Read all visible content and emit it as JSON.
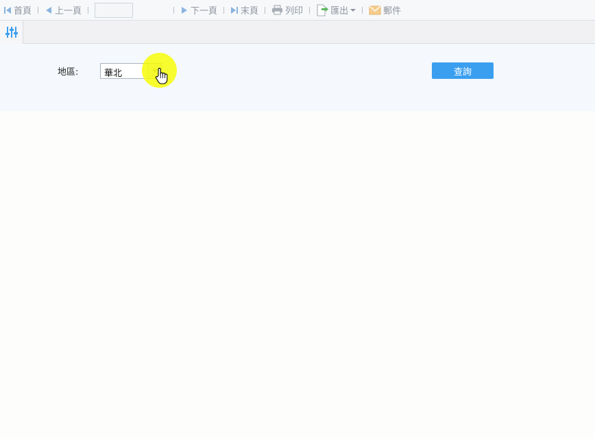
{
  "toolbar": {
    "first_label": "首頁",
    "prev_label": "上一頁",
    "page_value": "",
    "next_label": "下一頁",
    "last_label": "末頁",
    "print_label": "列印",
    "export_label": "匯出",
    "mail_label": "郵件"
  },
  "params": {
    "region_label": "地區:",
    "region_value": "華北",
    "query_label": "查詢"
  },
  "colors": {
    "accent": "#3b9ff0",
    "icon_blue": "#8ab4e0",
    "highlight": "#f6fc00"
  }
}
